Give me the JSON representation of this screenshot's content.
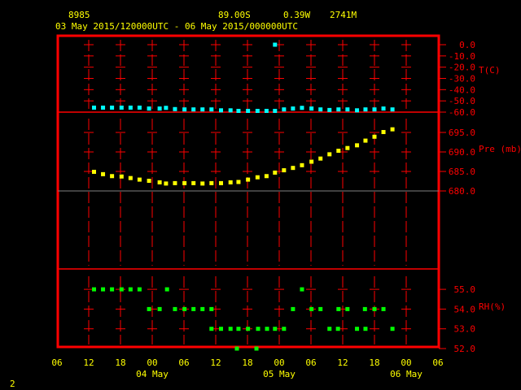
{
  "header": {
    "station": "8985",
    "lat": "89.00S",
    "lon": "0.39W",
    "elev": "2741M",
    "range": "03 May 2015/120000UTC - 06 May 2015/000000UTC"
  },
  "footer": {
    "page": "2"
  },
  "colors": {
    "axis": "#ff0000",
    "text": "#ffff00",
    "temp": "#00ffff",
    "pres": "#ffff00",
    "rh": "#00ff00",
    "ref": "#808080"
  },
  "chart_data": {
    "type": "scatter",
    "x_unit": "hours since 03 May 2015 06 UTC",
    "x_ticks": [
      0,
      6,
      12,
      18,
      24,
      30,
      36,
      42,
      48,
      54,
      60,
      66,
      72
    ],
    "x_tick_labels": [
      "06",
      "12",
      "18",
      "00",
      "06",
      "12",
      "18",
      "00",
      "06",
      "12",
      "18",
      "00",
      "06"
    ],
    "date_labels": [
      {
        "hour": 18,
        "label": "04 May"
      },
      {
        "hour": 42,
        "label": "05 May"
      },
      {
        "hour": 66,
        "label": "06 May"
      }
    ],
    "xlim": [
      0,
      72
    ],
    "panels": [
      {
        "name": "temperature",
        "ylabel": "T(C)",
        "ylim": [
          -60,
          0
        ],
        "ticks": [
          0,
          -10,
          -20,
          -30,
          -40,
          -50,
          -60
        ],
        "tick_labels": [
          "0.0",
          "-10.0",
          "-20.0",
          "-30.0",
          "-40.0",
          "-50.0",
          "-60.0"
        ],
        "points": [
          [
            7.0,
            -56.0
          ],
          [
            8.7,
            -56.0
          ],
          [
            10.4,
            -56.0
          ],
          [
            12.2,
            -56.0
          ],
          [
            13.9,
            -56.0
          ],
          [
            15.6,
            -56.0
          ],
          [
            17.4,
            -56.8
          ],
          [
            19.4,
            -56.8
          ],
          [
            20.6,
            -56.2
          ],
          [
            22.3,
            -57.3
          ],
          [
            24.1,
            -57.6
          ],
          [
            25.8,
            -57.6
          ],
          [
            27.5,
            -57.6
          ],
          [
            29.2,
            -57.6
          ],
          [
            31.0,
            -58.4
          ],
          [
            32.8,
            -58.4
          ],
          [
            34.3,
            -58.9
          ],
          [
            36.1,
            -58.9
          ],
          [
            37.9,
            -58.9
          ],
          [
            39.6,
            -58.9
          ],
          [
            41.2,
            -58.9
          ],
          [
            42.9,
            -57.6
          ],
          [
            44.6,
            -56.8
          ],
          [
            46.3,
            -56.2
          ],
          [
            48.1,
            -56.8
          ],
          [
            49.8,
            -57.6
          ],
          [
            51.5,
            -58.1
          ],
          [
            53.2,
            -57.6
          ],
          [
            54.9,
            -57.6
          ],
          [
            56.7,
            -58.4
          ],
          [
            58.3,
            -57.6
          ],
          [
            60.0,
            -57.6
          ],
          [
            61.7,
            -56.8
          ],
          [
            63.4,
            -57.6
          ],
          [
            41.2,
            0.0
          ]
        ]
      },
      {
        "name": "pressure",
        "ylabel": "Pre (mb)",
        "ylim": [
          680,
          695
        ],
        "ticks": [
          695,
          690,
          685,
          680
        ],
        "tick_labels": [
          "695.0",
          "690.0",
          "685.0",
          "680.0"
        ],
        "points": [
          [
            7.0,
            684.9
          ],
          [
            8.7,
            684.3
          ],
          [
            10.4,
            683.8
          ],
          [
            12.2,
            683.7
          ],
          [
            13.9,
            683.3
          ],
          [
            15.6,
            682.9
          ],
          [
            17.4,
            682.6
          ],
          [
            19.4,
            682.2
          ],
          [
            20.6,
            681.9
          ],
          [
            22.3,
            682.0
          ],
          [
            24.1,
            682.0
          ],
          [
            25.8,
            682.0
          ],
          [
            27.5,
            681.9
          ],
          [
            29.2,
            682.0
          ],
          [
            31.0,
            682.0
          ],
          [
            32.8,
            682.2
          ],
          [
            34.3,
            682.3
          ],
          [
            36.1,
            682.9
          ],
          [
            37.9,
            683.5
          ],
          [
            39.6,
            683.8
          ],
          [
            41.2,
            684.7
          ],
          [
            42.9,
            685.3
          ],
          [
            44.6,
            685.9
          ],
          [
            46.3,
            686.6
          ],
          [
            48.1,
            687.5
          ],
          [
            49.8,
            688.3
          ],
          [
            51.5,
            689.4
          ],
          [
            53.2,
            690.3
          ],
          [
            54.9,
            691.0
          ],
          [
            56.7,
            691.7
          ],
          [
            58.3,
            692.9
          ],
          [
            60.0,
            693.9
          ],
          [
            61.7,
            695.1
          ],
          [
            63.4,
            695.8
          ]
        ]
      },
      {
        "name": "rh",
        "ylabel": "RH(%)",
        "ylim": [
          52,
          55
        ],
        "ticks": [
          55,
          54,
          53,
          52
        ],
        "tick_labels": [
          "55.0",
          "54.0",
          "53.0",
          "52.0"
        ],
        "points": [
          [
            7.0,
            55
          ],
          [
            8.7,
            55
          ],
          [
            10.4,
            55
          ],
          [
            12.2,
            55
          ],
          [
            13.9,
            55
          ],
          [
            15.6,
            55
          ],
          [
            20.8,
            55
          ],
          [
            46.3,
            55
          ],
          [
            17.4,
            54
          ],
          [
            19.4,
            54
          ],
          [
            22.3,
            54
          ],
          [
            24.1,
            54
          ],
          [
            25.8,
            54
          ],
          [
            27.5,
            54
          ],
          [
            29.2,
            54
          ],
          [
            44.6,
            54
          ],
          [
            48.1,
            54
          ],
          [
            49.8,
            54
          ],
          [
            53.2,
            54
          ],
          [
            54.9,
            54
          ],
          [
            58.2,
            54
          ],
          [
            60.0,
            54
          ],
          [
            61.7,
            54
          ],
          [
            29.2,
            53
          ],
          [
            31.0,
            53
          ],
          [
            32.8,
            53
          ],
          [
            34.3,
            53
          ],
          [
            36.1,
            53
          ],
          [
            38.0,
            53
          ],
          [
            39.7,
            53
          ],
          [
            41.2,
            53
          ],
          [
            42.9,
            53
          ],
          [
            51.5,
            53
          ],
          [
            53.1,
            53
          ],
          [
            56.7,
            53
          ],
          [
            58.3,
            53
          ],
          [
            63.4,
            53
          ],
          [
            34.0,
            52
          ],
          [
            37.7,
            52
          ]
        ]
      }
    ]
  }
}
